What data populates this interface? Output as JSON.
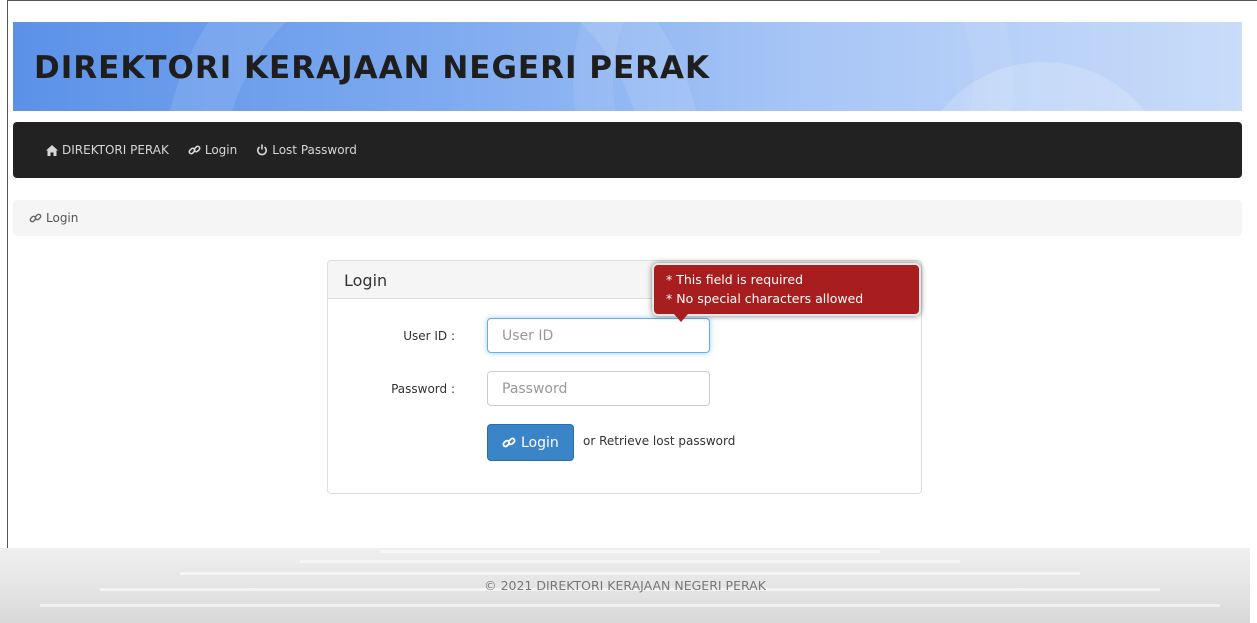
{
  "header": {
    "title": "DIREKTORI KERAJAAN NEGERI PERAK"
  },
  "nav": {
    "items": [
      {
        "label": "DIREKTORI PERAK",
        "icon": "home-icon"
      },
      {
        "label": "Login",
        "icon": "link-icon"
      },
      {
        "label": "Lost Password",
        "icon": "power-icon"
      }
    ]
  },
  "breadcrumb": {
    "label": "Login",
    "icon": "link-icon"
  },
  "login_panel": {
    "heading": "Login",
    "user_id_label": "User ID :",
    "user_id_placeholder": "User ID",
    "user_id_value": "",
    "password_label": "Password :",
    "password_placeholder": "Password",
    "password_value": "",
    "login_button": "Login",
    "retrieve_text": "or Retrieve lost password"
  },
  "validation_tooltip": {
    "line1": "* This field is required",
    "line2": "* No special characters allowed"
  },
  "footer": {
    "text": "© 2021 DIREKTORI KERAJAAN NEGERI PERAK"
  },
  "colors": {
    "navbar": "#222222",
    "primary_button": "#3a84c7",
    "tooltip": "#a81e1e"
  }
}
